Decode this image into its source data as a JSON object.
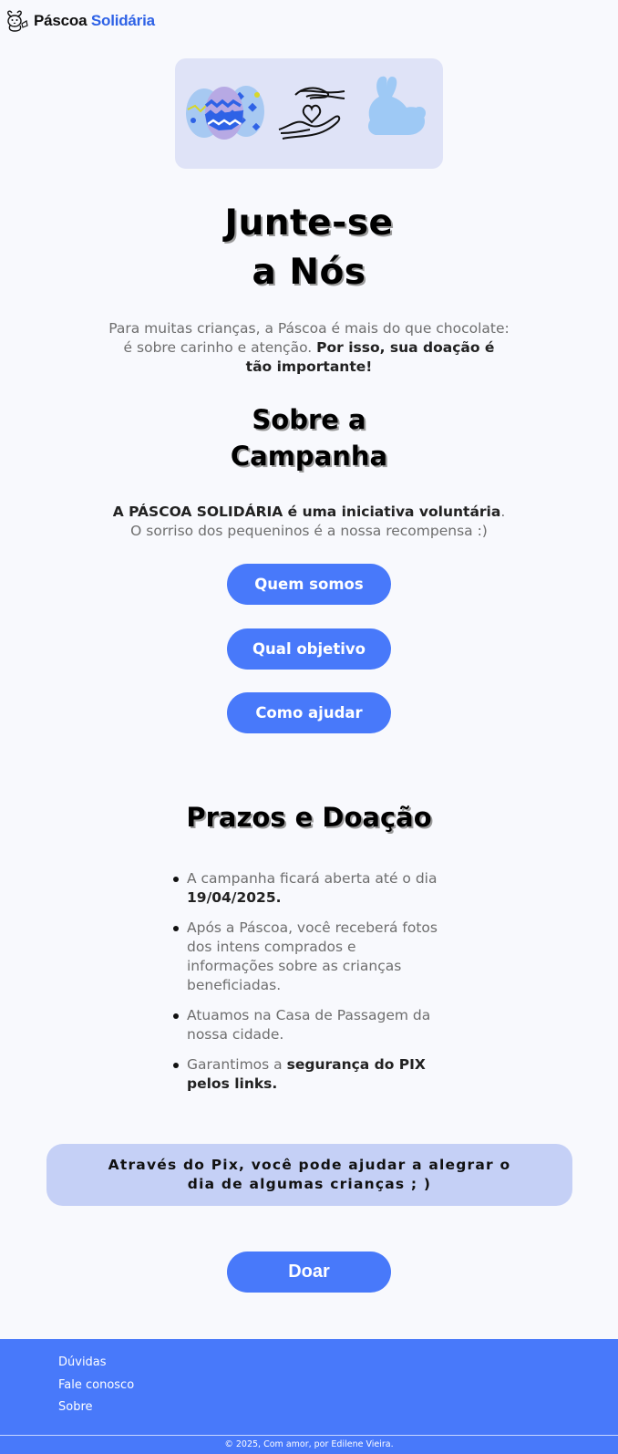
{
  "header": {
    "logo_icon": "bunny-icon",
    "brand_part1": "Páscoa",
    "brand_part2": "Solidária"
  },
  "hero": {
    "icons": [
      "easter-eggs-icon",
      "heart-hands-icon",
      "bunny-silhouette-icon"
    ]
  },
  "intro": {
    "title_line1": "Junte-se",
    "title_line2": "a Nós",
    "text": "Para muitas crianças, a Páscoa é mais do que chocolate: é sobre carinho e atenção.",
    "text_bold": "Por isso, sua doação é tão importante!"
  },
  "about": {
    "title_line1": "Sobre a",
    "title_line2": "Campanha",
    "text_bold": "A PÁSCOA SOLIDÁRIA é uma iniciativa voluntária",
    "text": ". O sorriso dos pequeninos é a nossa recompensa :)",
    "buttons": [
      "Quem somos",
      "Qual objetivo",
      "Como ajudar"
    ]
  },
  "deadlines": {
    "title": "Prazos e Doação",
    "items": [
      {
        "text": "A campanha ficará aberta até o dia ",
        "bold": "19/04/2025."
      },
      {
        "text": "Após a Páscoa, você receberá fotos dos intens comprados e informações sobre as crianças beneficiadas.",
        "bold": ""
      },
      {
        "text": "Atuamos na Casa de Passagem da nossa cidade.",
        "bold": ""
      },
      {
        "text": "Garantimos a ",
        "bold": "segurança do PIX pelos links."
      }
    ]
  },
  "pix": {
    "message": "Através do Pix, você pode ajudar a alegrar o dia de algumas crianças ; )"
  },
  "donate": {
    "label": "Doar"
  },
  "footer": {
    "links": [
      "Dúvidas",
      "Fale conosco",
      "Sobre"
    ],
    "copyright": "© 2025, Com amor, por Edilene Vieira."
  },
  "colors": {
    "accent": "#4879fa",
    "brand_blue": "#2e62e6",
    "hero_bg": "#dfe3f7",
    "pix_bg": "#c5d0f6",
    "page_bg": "#f8f9fd"
  }
}
